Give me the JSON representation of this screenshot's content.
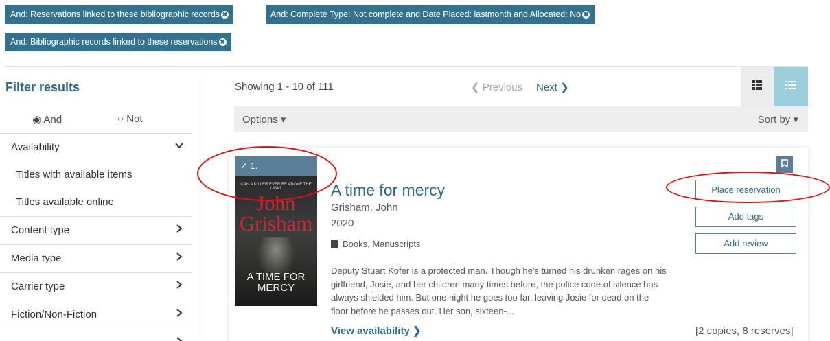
{
  "filters": {
    "chips": [
      {
        "label": "And: Reservations linked to these bibliographic records"
      },
      {
        "label": "And: Complete Type: Not complete and Date Placed: lastmonth and Allocated: No"
      },
      {
        "label": "And: Bibliographic records linked to these reservations"
      }
    ],
    "remove_glyph": "✖"
  },
  "sidebar": {
    "title": "Filter results",
    "radio_and": "◉ And",
    "radio_not": "○ Not",
    "availability": {
      "label": "Availability",
      "options": [
        "Titles with available items",
        "Titles available online"
      ]
    },
    "facets": [
      {
        "label": "Content type"
      },
      {
        "label": "Media type"
      },
      {
        "label": "Carrier type"
      },
      {
        "label": "Fiction/Non-Fiction"
      }
    ]
  },
  "results": {
    "showing": "Showing 1 - 10 of 111",
    "previous": "❮ Previous",
    "next": "Next ❯",
    "options": "Options ▾",
    "sort_by": "Sort by ▾"
  },
  "item": {
    "number": "✓ 1.",
    "title": "A time for mercy",
    "author": "Grisham, John",
    "year": "2020",
    "format": "Books, Manuscripts",
    "description": "Deputy Stuart Kofer is a protected man. Though he's turned his drunken rages on his girlfriend, Josie, and her children many times before, the police code of silence has always shielded him. But one night he goes too far, leaving Josie for dead on the floor before he passes out. Her son, sixteen-...",
    "view_availability": "View availability ❯",
    "copies": "[2 copies, 8 reserves]",
    "cover": {
      "tagline": "CAN A KILLER EVER BE ABOVE THE LAW?",
      "author_first": "John",
      "author_last": "Grisham",
      "cover_title": "A TIME FOR MERCY"
    },
    "buttons": {
      "place_reservation": "Place reservation",
      "add_tags": "Add tags",
      "add_review": "Add review"
    }
  },
  "colors": {
    "chip_bg": "#33728f",
    "link": "#2c6b8a",
    "accent_red_annotation": "#e01010",
    "list_view_active": "#9ccfdb"
  }
}
